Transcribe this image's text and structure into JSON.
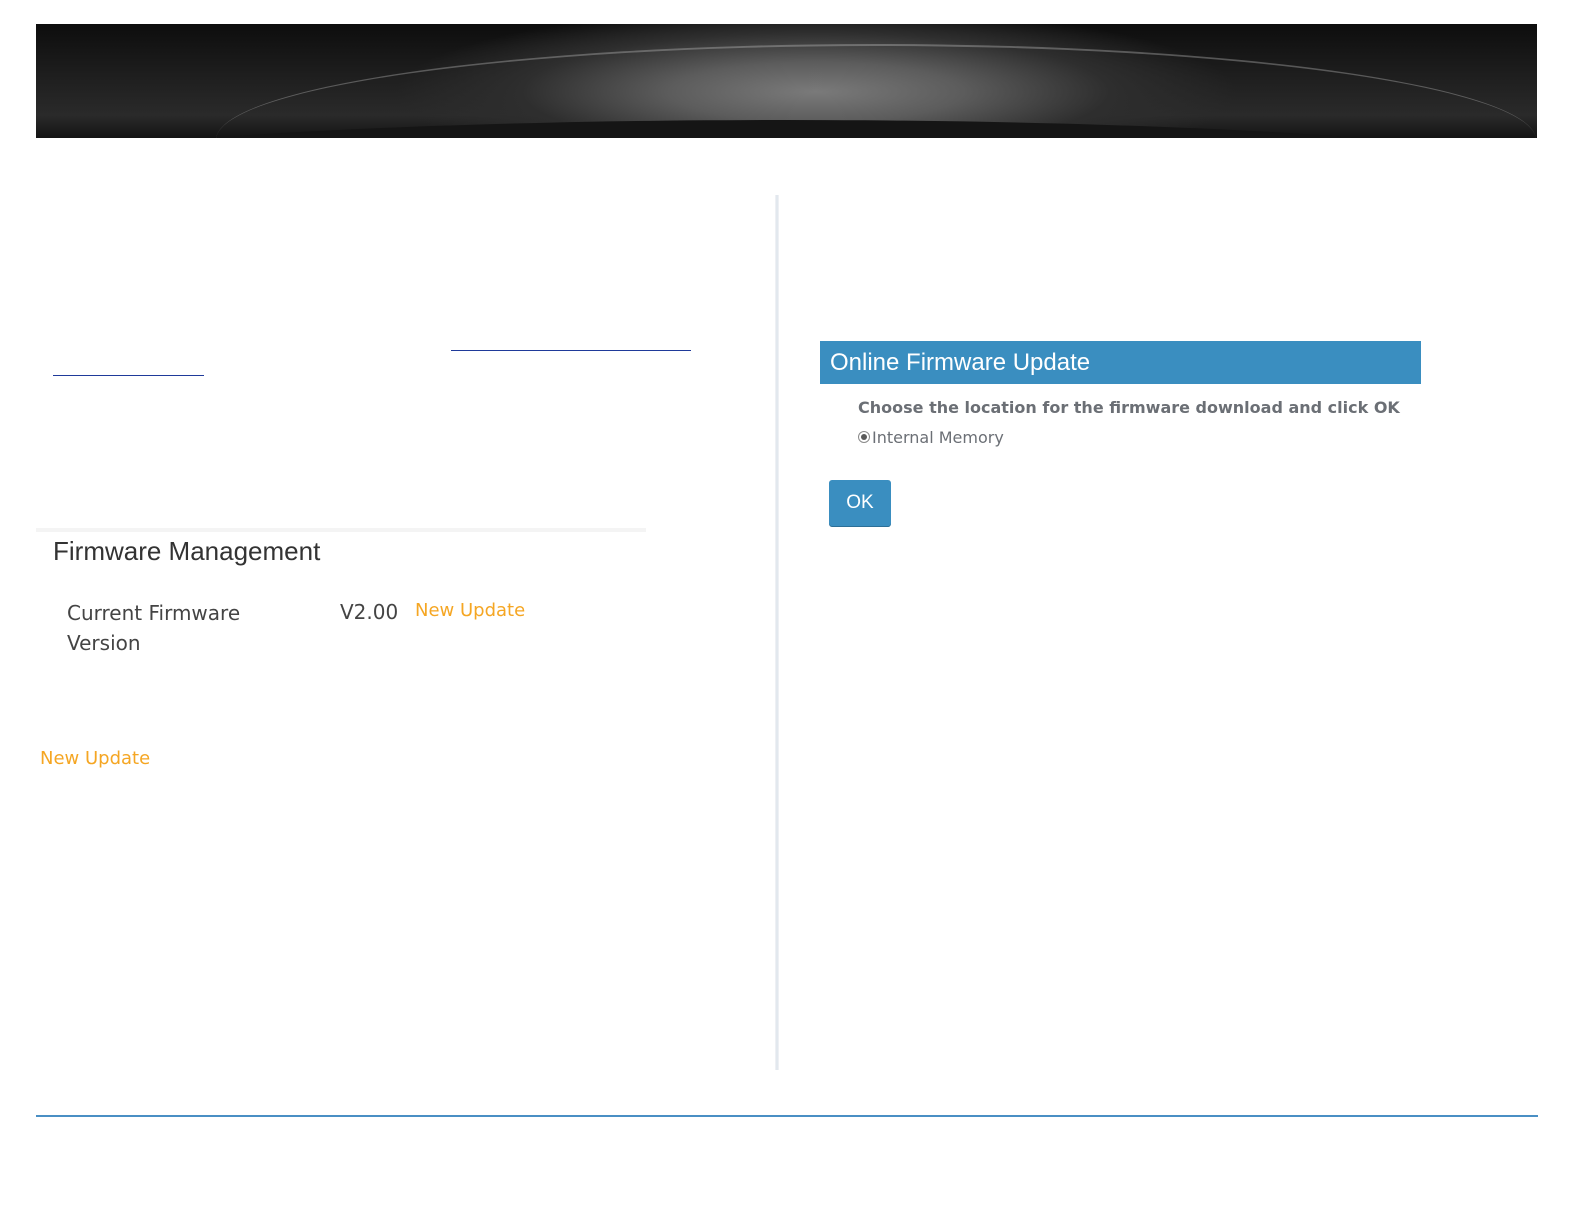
{
  "firmware_management": {
    "title": "Firmware Management",
    "current_firmware_label": "Current Firmware Version",
    "current_firmware_value": "V2.00",
    "new_update_link": "New Update"
  },
  "standalone_link": {
    "label": "New Update"
  },
  "online_update": {
    "header": "Online Firmware Update",
    "instruction": "Choose the location for the firmware download and click OK",
    "option_label": "Internal Memory",
    "option_selected": true,
    "ok_label": "OK"
  },
  "colors": {
    "accent_blue": "#3a8ec0",
    "link_orange": "#f5a623",
    "footer_rule": "#4a8fc4"
  }
}
